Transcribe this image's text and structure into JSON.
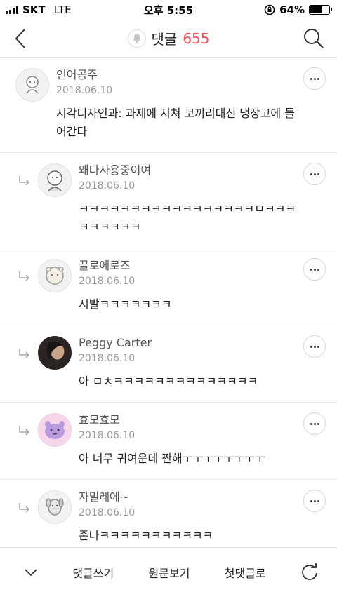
{
  "status_bar": {
    "carrier": "SKT",
    "network": "LTE",
    "time": "오후 5:55",
    "battery": "64%",
    "battery_level": 0.64
  },
  "header": {
    "title": "댓글",
    "count": "655",
    "back_icon": "back-chevron-icon",
    "search_icon": "search-icon"
  },
  "comments": [
    {
      "name": "인어공주",
      "date": "2018.06.10",
      "text": "시각디자인과: 과제에 지쳐 코끼리대신 냉장고에 들어간다",
      "reply": false
    },
    {
      "name": "왜다사용중이여",
      "date": "2018.06.10",
      "text": "ㅋㅋㅋㅋㅋㅋㅋㅋㅋㅋㅋㅋㅋㅋㅋㅋㅋㅁㅋㅋㅋㅋㅋㅋㅋㅋㅋ",
      "reply": true
    },
    {
      "name": "끌로에로즈",
      "date": "2018.06.10",
      "text": "시발ㅋㅋㅋㅋㅋㅋㅋ",
      "reply": true
    },
    {
      "name": "Peggy Carter",
      "date": "2018.06.10",
      "text": "아 ㅁㅊㅋㅋㅋㅋㅋㅋㅋㅋㅋㅋㅋㅋㅋㅋ",
      "reply": true
    },
    {
      "name": "효모효모",
      "date": "2018.06.10",
      "text": "아 너무 귀여운데 짠해ㅜㅜㅜㅜㅜㅜㅜㅜ",
      "reply": true
    },
    {
      "name": "자밀레에~",
      "date": "2018.06.10",
      "text": "존나ㅋㅋㅋㅋㅋㅋㅋㅋㅋㅋㅋ",
      "reply": true
    }
  ],
  "bottom_bar": {
    "write": "댓글쓰기",
    "view_original": "원문보기",
    "first_comment": "첫댓글로"
  }
}
